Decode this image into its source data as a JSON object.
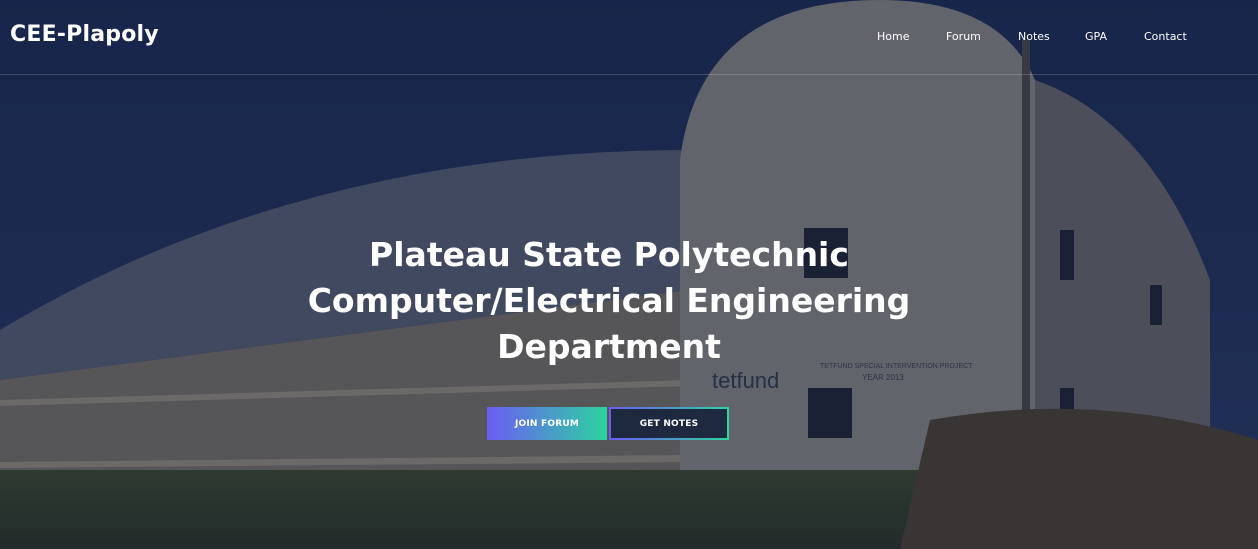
{
  "navbar": {
    "brand": "CEE-Plapoly",
    "links": [
      {
        "label": "Home"
      },
      {
        "label": "Forum"
      },
      {
        "label": "Notes"
      },
      {
        "label": "GPA"
      },
      {
        "label": "Contact"
      }
    ]
  },
  "hero": {
    "headline_line1": "Plateau State Polytechnic",
    "headline_line2": "Computer/Electrical Engineering",
    "headline_line3": "Department",
    "background_sign_text": "tetfund",
    "background_plaque_line1": "TETFUND SPECIAL INTERVENTION PROJECT",
    "background_plaque_line2": "YEAR 2013",
    "buttons": {
      "join_forum": "JOIN FORUM",
      "get_notes": "GET NOTES"
    }
  },
  "colors": {
    "gradient_start": "#6c5cf5",
    "gradient_end": "#2cd3a0",
    "sky": "#1c2b4f",
    "text": "#ffffff"
  }
}
